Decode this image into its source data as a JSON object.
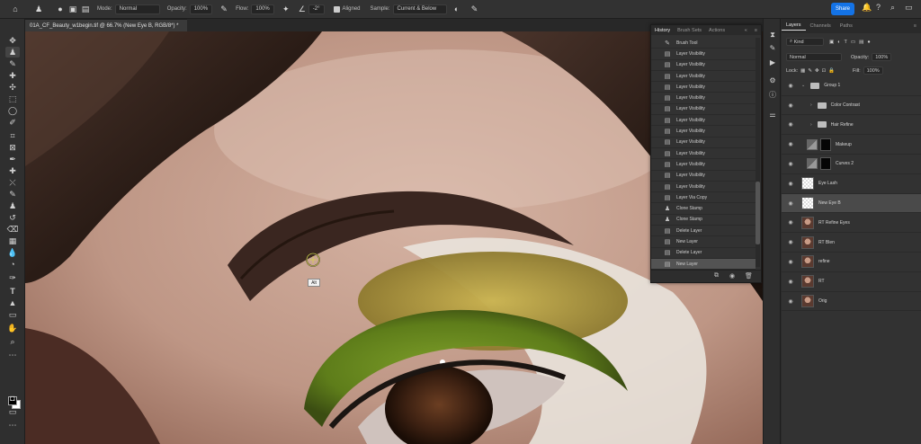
{
  "options": {
    "mode_label": "Mode:",
    "mode_value": "Normal",
    "opacity_label": "Opacity:",
    "opacity_value": "100%",
    "flow_label": "Flow:",
    "flow_value": "100%",
    "angle_value": "-2°",
    "aligned_label": "Aligned",
    "sample_label": "Sample:",
    "sample_value": "Current & Below",
    "share_label": "Share"
  },
  "document": {
    "tab_title": "01A_CF_Beauty_w1begin.tif @ 66.7% (New Eye B, RGB/8*) *"
  },
  "canvas": {
    "tooltip": "Alt"
  },
  "history": {
    "tabs": [
      "History",
      "Brush Sets",
      "Actions"
    ],
    "items": [
      {
        "label": "Brush Tool",
        "icon": "brush-icon"
      },
      {
        "label": "Layer Visibility",
        "icon": "doc-icon"
      },
      {
        "label": "Layer Visibility",
        "icon": "doc-icon"
      },
      {
        "label": "Layer Visibility",
        "icon": "doc-icon"
      },
      {
        "label": "Layer Visibility",
        "icon": "doc-icon"
      },
      {
        "label": "Layer Visibility",
        "icon": "doc-icon"
      },
      {
        "label": "Layer Visibility",
        "icon": "doc-icon"
      },
      {
        "label": "Layer Visibility",
        "icon": "doc-icon"
      },
      {
        "label": "Layer Visibility",
        "icon": "doc-icon"
      },
      {
        "label": "Layer Visibility",
        "icon": "doc-icon"
      },
      {
        "label": "Layer Visibility",
        "icon": "doc-icon"
      },
      {
        "label": "Layer Visibility",
        "icon": "doc-icon"
      },
      {
        "label": "Layer Visibility",
        "icon": "doc-icon"
      },
      {
        "label": "Layer Visibility",
        "icon": "doc-icon"
      },
      {
        "label": "Layer Via Copy",
        "icon": "doc-icon"
      },
      {
        "label": "Clone Stamp",
        "icon": "stamp-icon"
      },
      {
        "label": "Clone Stamp",
        "icon": "stamp-icon"
      },
      {
        "label": "Delete Layer",
        "icon": "doc-icon"
      },
      {
        "label": "New Layer",
        "icon": "doc-icon"
      },
      {
        "label": "Delete Layer",
        "icon": "doc-icon"
      },
      {
        "label": "New Layer",
        "icon": "doc-icon",
        "selected": true
      },
      {
        "label": "Clone Stamp",
        "icon": "stamp-icon",
        "dim": true
      }
    ]
  },
  "layers": {
    "tabs": [
      "Layers",
      "Channels",
      "Paths"
    ],
    "filter_kind": "Kind",
    "blend_mode": "Normal",
    "opacity_label": "Opacity:",
    "opacity_value": "100%",
    "lock_label": "Lock:",
    "fill_label": "Fill:",
    "fill_value": "100%",
    "items": [
      {
        "name": "Group 1",
        "type": "group"
      },
      {
        "name": "Color Contrast",
        "type": "group",
        "indent": 1
      },
      {
        "name": "Hair Refine",
        "type": "group",
        "indent": 1
      },
      {
        "name": "Makeup",
        "type": "adjustment"
      },
      {
        "name": "Curves 2",
        "type": "adjustment"
      },
      {
        "name": "Eye Lash",
        "type": "pixel-empty"
      },
      {
        "name": "New Eye B",
        "type": "pixel-empty",
        "selected": true
      },
      {
        "name": "RT Refine Eyes",
        "type": "pixel-face"
      },
      {
        "name": "RT Blen",
        "type": "pixel-face"
      },
      {
        "name": "refine",
        "type": "pixel-face"
      },
      {
        "name": "RT",
        "type": "pixel-face"
      },
      {
        "name": "Orig",
        "type": "pixel-face"
      }
    ]
  }
}
